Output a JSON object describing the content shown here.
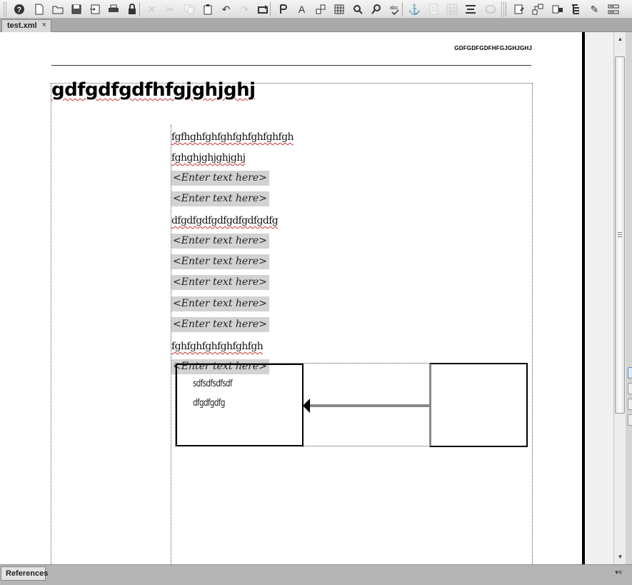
{
  "toolbar": {
    "buttons": [
      {
        "name": "help-icon",
        "glyph": "?",
        "enabled": true
      },
      {
        "name": "new-document-icon",
        "glyph": "new",
        "enabled": true
      },
      {
        "name": "open-folder-icon",
        "glyph": "open",
        "enabled": true
      },
      {
        "name": "save-icon",
        "glyph": "save",
        "enabled": true
      },
      {
        "name": "import-icon",
        "glyph": "import",
        "enabled": true
      },
      {
        "name": "print-icon",
        "glyph": "print",
        "enabled": true
      },
      {
        "name": "lock-icon",
        "glyph": "lock",
        "enabled": true
      },
      {
        "name": "delete-icon",
        "glyph": "✕",
        "enabled": false
      },
      {
        "name": "cut-icon",
        "glyph": "✂",
        "enabled": false
      },
      {
        "name": "copy-icon",
        "glyph": "copy",
        "enabled": false
      },
      {
        "name": "paste-icon",
        "glyph": "paste",
        "enabled": true
      },
      {
        "name": "undo-icon",
        "glyph": "↶",
        "enabled": true
      },
      {
        "name": "redo-icon",
        "glyph": "↷",
        "enabled": false
      },
      {
        "name": "forward-icon",
        "glyph": "fwd",
        "enabled": true
      },
      {
        "name": "insert-element-icon",
        "glyph": "ins",
        "enabled": true
      },
      {
        "name": "insert-text-icon",
        "glyph": "A",
        "enabled": true
      },
      {
        "name": "insert-graphic-icon",
        "glyph": "gfx",
        "enabled": true
      },
      {
        "name": "insert-table-icon",
        "glyph": "tbl",
        "enabled": true
      },
      {
        "name": "find-icon",
        "glyph": "find",
        "enabled": true
      },
      {
        "name": "zoom-icon",
        "glyph": "zoom",
        "enabled": true
      },
      {
        "name": "spellcheck-icon",
        "glyph": "abc",
        "enabled": true
      },
      {
        "name": "anchor-icon",
        "glyph": "⚓",
        "enabled": true
      },
      {
        "name": "page-icon",
        "glyph": "page",
        "enabled": false
      },
      {
        "name": "grid-icon",
        "glyph": "grid",
        "enabled": false
      },
      {
        "name": "align-icon",
        "glyph": "align",
        "enabled": true
      },
      {
        "name": "link-icon",
        "glyph": "link",
        "enabled": false
      },
      {
        "name": "edit-icon",
        "glyph": "edit",
        "enabled": true
      },
      {
        "name": "structure-icon",
        "glyph": "struct",
        "enabled": true
      },
      {
        "name": "attributes-icon",
        "glyph": "attr",
        "enabled": true
      },
      {
        "name": "tree-icon",
        "glyph": "tree",
        "enabled": true
      },
      {
        "name": "pencil-icon",
        "glyph": "✎",
        "enabled": true
      },
      {
        "name": "list-icon",
        "glyph": "list",
        "enabled": true
      }
    ]
  },
  "tabs": {
    "active_label": "test.xml",
    "close_glyph": "×"
  },
  "document": {
    "header_text": "GDFGDFGDFHFGJGHJGHJ",
    "title": "gdfgdfgdfhfgjghjghj",
    "paragraphs": [
      {
        "text": "fgfhghfghfghfghfghfghfgh",
        "placeholder": false
      },
      {
        "text": "fghghjghjghjghj",
        "placeholder": false
      },
      {
        "text": "<Enter text here>",
        "placeholder": true
      },
      {
        "text": "<Enter text here>",
        "placeholder": true
      },
      {
        "text": "dfgdfgdfgdfgdfgdfgdfg",
        "placeholder": false
      },
      {
        "text": "<Enter text here>",
        "placeholder": true
      },
      {
        "text": "<Enter text here>",
        "placeholder": true
      },
      {
        "text": "<Enter text here>",
        "placeholder": true
      },
      {
        "text": "<Enter text here>",
        "placeholder": true
      },
      {
        "text": "<Enter text here>",
        "placeholder": true
      },
      {
        "text": "fghfghfghfghfghfgh",
        "placeholder": false
      },
      {
        "text": "<Enter text here>",
        "placeholder": true
      }
    ],
    "diagram": {
      "box_lines": [
        "sdfsdfsdfsdf",
        "dfgdfgdfg"
      ]
    }
  },
  "bottom_panel": {
    "tab_label": "References",
    "menu_glyph": "▾≡"
  }
}
